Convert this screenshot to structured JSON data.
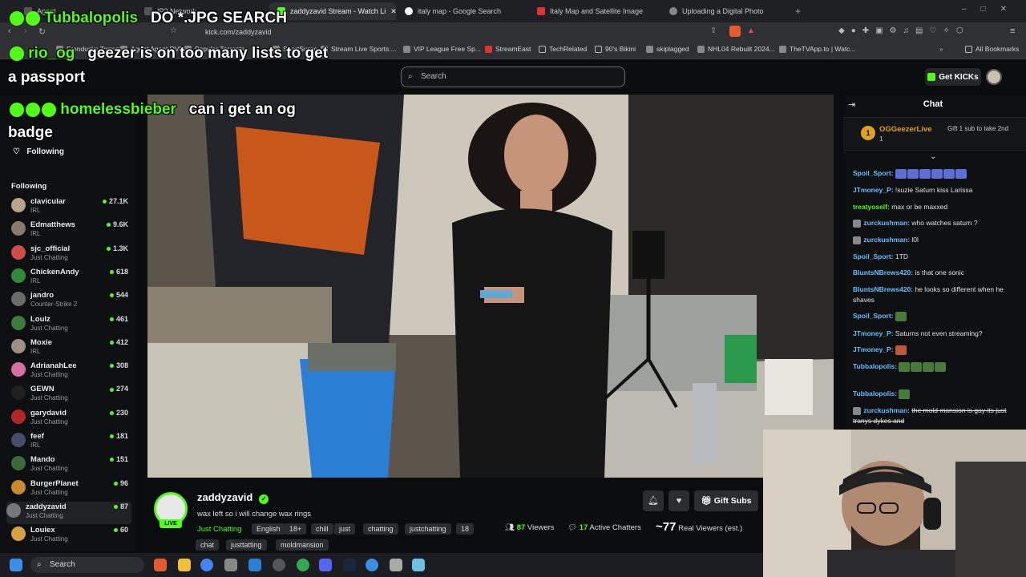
{
  "browser": {
    "tabs": [
      {
        "label": "Agent"
      },
      {
        "label": "IP2 Network"
      },
      {
        "label": "zaddyzavid Stream - Watch Li"
      },
      {
        "label": "italy map - Google Search"
      },
      {
        "label": "Italy Map and Satellite Image"
      },
      {
        "label": "Uploading a Digital Photo"
      }
    ],
    "url": "kick.com/zaddyzavid",
    "bookmarks": [
      "Frenducks Torrents",
      "Agent Agent DVR",
      "Popular Torrents",
      "SportSurge",
      "Stream Live Sports:...",
      "VIP League Free Sp...",
      "StreamEast",
      "TechRelated",
      "90's Bikini",
      "skiplagged",
      "NHL04 Rebuilt 2024...",
      "TheTVApp.to | Watc..."
    ],
    "all_bookmarks": "All Bookmarks"
  },
  "header": {
    "search_placeholder": "Search",
    "get_kicks": "Get KICKs"
  },
  "sidebar": {
    "following_label": "Following",
    "section_title": "Following",
    "channels": [
      {
        "name": "clavicular",
        "category": "IRL",
        "viewers": "27.1K",
        "color": "#b8a48c"
      },
      {
        "name": "Edmatthews",
        "category": "IRL",
        "viewers": "9.6K",
        "color": "#8a7a6e"
      },
      {
        "name": "sjc_official",
        "category": "Just Chatting",
        "viewers": "1.3K",
        "color": "#d04b4b"
      },
      {
        "name": "ChickenAndy",
        "category": "IRL",
        "viewers": "618",
        "color": "#2f8a3a"
      },
      {
        "name": "jandro",
        "category": "Counter-Strike 2",
        "viewers": "544",
        "color": "#6b6b6b"
      },
      {
        "name": "Loulz",
        "category": "Just Chatting",
        "viewers": "461",
        "color": "#3d7a3d"
      },
      {
        "name": "Moxie",
        "category": "IRL",
        "viewers": "412",
        "color": "#9c8f86"
      },
      {
        "name": "AdrianahLee",
        "category": "Just Chatting",
        "viewers": "308",
        "color": "#d76fa3"
      },
      {
        "name": "GEWN",
        "category": "Just Chatting",
        "viewers": "274",
        "color": "#202020"
      },
      {
        "name": "garydavid",
        "category": "Just Chatting",
        "viewers": "230",
        "color": "#b32626"
      },
      {
        "name": "feef",
        "category": "IRL",
        "viewers": "181",
        "color": "#4a4a6a"
      },
      {
        "name": "Mando",
        "category": "Just Chatting",
        "viewers": "151",
        "color": "#3a6a3a"
      },
      {
        "name": "BurgerPlanet",
        "category": "Just Chatting",
        "viewers": "96",
        "color": "#c98a2a"
      },
      {
        "name": "zaddyzavid",
        "category": "Just Chatting",
        "viewers": "87",
        "color": "#777"
      },
      {
        "name": "Louiex",
        "category": "Just Chatting",
        "viewers": "60",
        "color": "#d8a040"
      }
    ]
  },
  "stream": {
    "streamer": "zaddyzavid",
    "live_badge": "LIVE",
    "title": "wax left so i will change wax rings",
    "category": "Just Chatting",
    "tags": [
      "English",
      "18+",
      "chill",
      "just",
      "chatting",
      "justchatting",
      "18",
      "chat",
      "justtatting",
      "moldmansion"
    ],
    "viewers_count": "87",
    "viewers_label": "Viewers",
    "chatters_count": "17",
    "chatters_label": "Active Chatters",
    "real_viewers_count": "~77",
    "real_viewers_label": "Real Viewers (est.)",
    "gift_subs": "Gift Subs"
  },
  "chat": {
    "title": "Chat",
    "pinned": {
      "user": "OGGeezerLive",
      "count": "1",
      "gift_text": "Gift 1 sub to take 2nd"
    },
    "messages": [
      {
        "user": "Spoil_Sport:",
        "text": "",
        "color": "#67c0ff"
      },
      {
        "user": "JTmoney_P:",
        "text": "!suzie Saturn kiss Larissa",
        "color": "#67c0ff"
      },
      {
        "user": "treatyoself:",
        "text": "max or be maxxed",
        "color": "#53fc18"
      },
      {
        "user": "zurckushman:",
        "text": "who watches saturn ?",
        "color": "#67c0ff"
      },
      {
        "user": "zurckushman:",
        "text": "l0l",
        "color": "#67c0ff"
      },
      {
        "user": "Spoil_Sport:",
        "text": "1TD",
        "color": "#67c0ff"
      },
      {
        "user": "BluntsNBrews420:",
        "text": "is that one sonic",
        "color": "#67c0ff"
      },
      {
        "user": "BluntsNBrews420:",
        "text": "he looks so different when he shaves",
        "color": "#67c0ff"
      },
      {
        "user": "Spoil_Sport:",
        "text": "",
        "color": "#67c0ff"
      },
      {
        "user": "JTmoney_P:",
        "text": "Saturns not even streaming?",
        "color": "#67c0ff"
      },
      {
        "user": "JTmoney_P:",
        "text": "",
        "color": "#67c0ff"
      },
      {
        "user": "Tubbalopolis:",
        "text": "",
        "color": "#67c0ff"
      },
      {
        "user": "Tubbalopolis:",
        "text": "",
        "color": "#67c0ff"
      },
      {
        "user": "zurckushman:",
        "text": "the mold mansion is gay its just tranys dykes and",
        "color": "#67c0ff"
      }
    ]
  },
  "overlay": {
    "line1_name": "Tubbalopolis",
    "line1_msg": "DO *.JPG SEARCH",
    "line2_name": "rio_og",
    "line2_msg": "geezer is on too many lists to get",
    "line2_cont": "a passport",
    "line3_name": "homelessbieber",
    "line3_msg": "can i get an og",
    "line3_cont": "badge"
  },
  "taskbar": {
    "search": "Search"
  }
}
